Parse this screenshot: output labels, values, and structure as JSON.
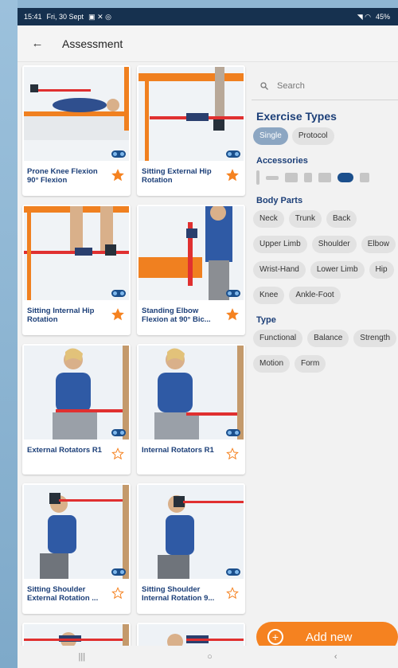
{
  "status_bar": {
    "time": "15:41",
    "date": "Fri, 30 Sept",
    "battery": "45%"
  },
  "app_bar": {
    "title": "Assessment"
  },
  "exercises": [
    {
      "label": "Prone Knee Flexion 90° Flexion",
      "starred": true
    },
    {
      "label": "Sitting External Hip Rotation",
      "starred": true
    },
    {
      "label": "Sitting Internal Hip Rotation",
      "starred": true
    },
    {
      "label": "Standing Elbow Flexion at 90° Bic...",
      "starred": true
    },
    {
      "label": "External Rotators R1",
      "starred": false
    },
    {
      "label": "Internal Rotators R1",
      "starred": false
    },
    {
      "label": "Sitting Shoulder External Rotation ...",
      "starred": false
    },
    {
      "label": "Sitting Shoulder Internal Rotation 9...",
      "starred": false
    }
  ],
  "filters": {
    "search_placeholder": "Search",
    "exercise_types_title": "Exercise Types",
    "exercise_types": [
      {
        "label": "Single",
        "selected": true
      },
      {
        "label": "Protocol",
        "selected": false
      }
    ],
    "accessories_title": "Accessories",
    "body_parts_title": "Body Parts",
    "body_parts": [
      "Neck",
      "Trunk",
      "Back",
      "Upper Limb",
      "Shoulder",
      "Elbow",
      "Wrist-Hand",
      "Lower Limb",
      "Hip",
      "Knee",
      "Ankle-Foot"
    ],
    "type_title": "Type",
    "types": [
      "Functional",
      "Balance",
      "Strength",
      "Motion",
      "Form"
    ]
  },
  "add_button": {
    "label": "Add new"
  },
  "colors": {
    "accent": "#f58220",
    "title_blue": "#1c3f78",
    "star": "#f58220",
    "status_bar": "#16314f"
  }
}
